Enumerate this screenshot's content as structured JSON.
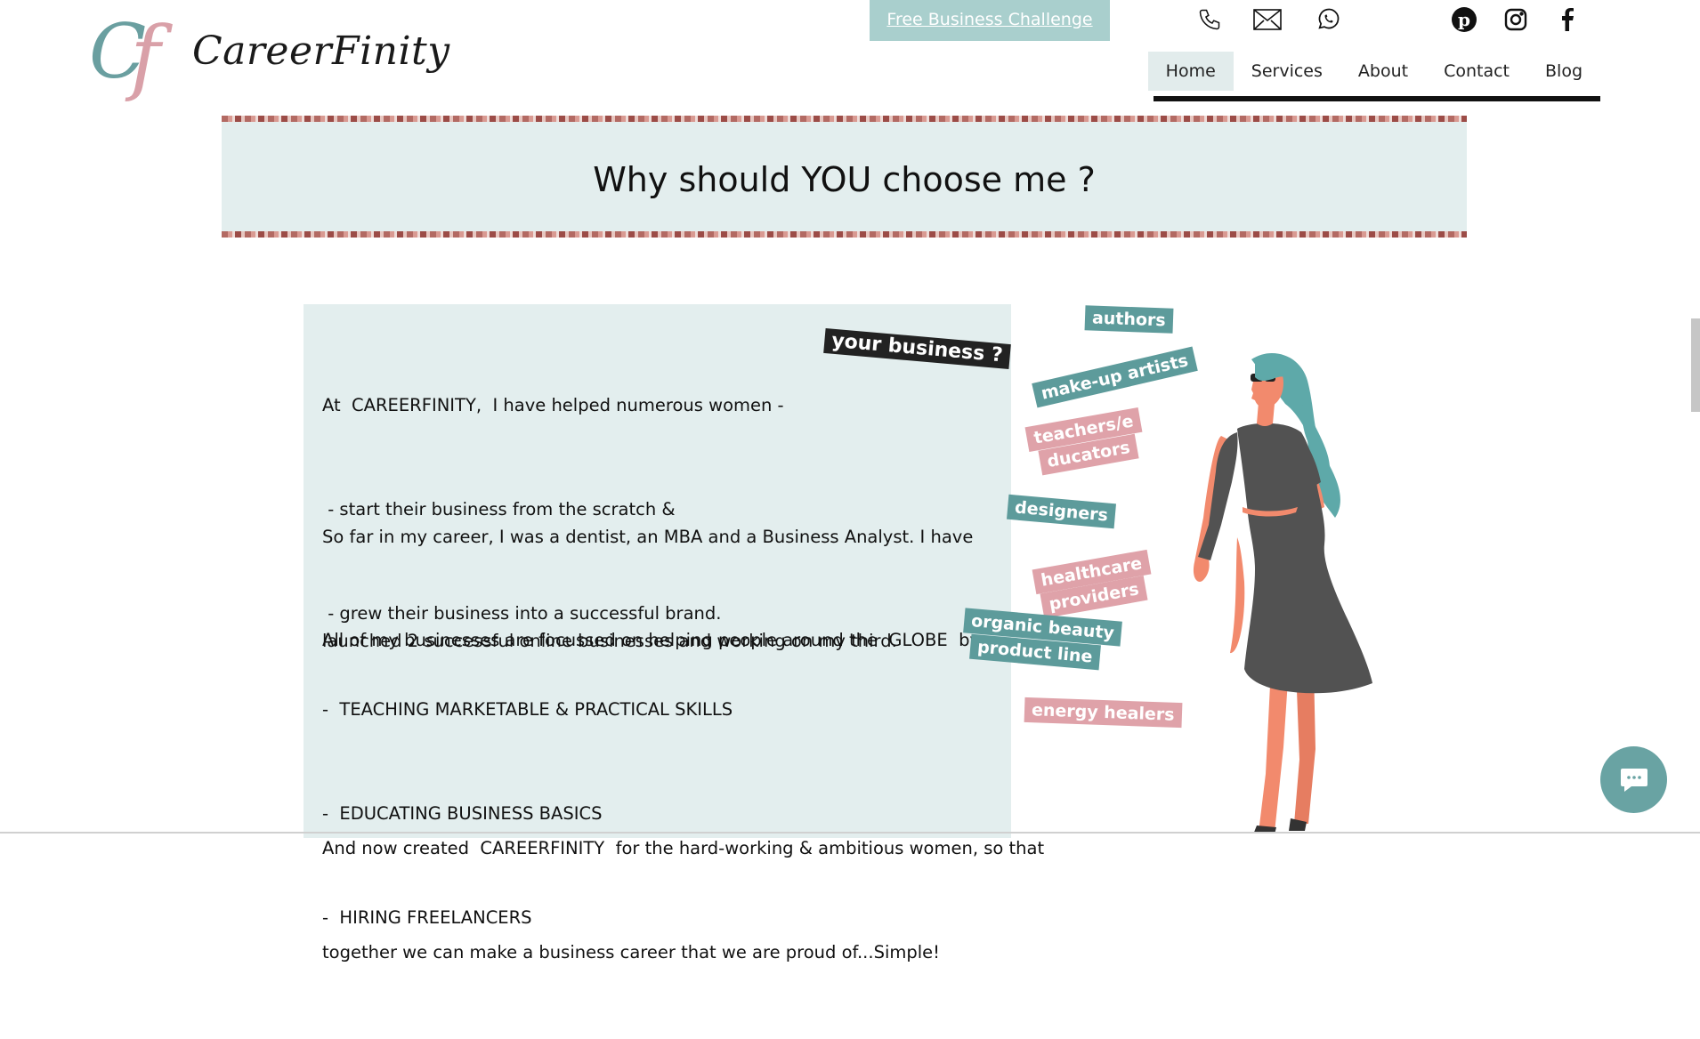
{
  "brand": {
    "logo_c": "C",
    "logo_f": "f",
    "name": "CareerFinity"
  },
  "header": {
    "cta_label": "Free Business Challenge",
    "contact_icons": [
      "phone-icon",
      "mail-icon",
      "whatsapp-icon"
    ],
    "social_icons": [
      "pinterest-icon",
      "instagram-icon",
      "facebook-icon"
    ]
  },
  "nav": {
    "items": [
      {
        "label": "Home",
        "active": true
      },
      {
        "label": "Services"
      },
      {
        "label": "About"
      },
      {
        "label": "Contact"
      },
      {
        "label": "Blog"
      }
    ]
  },
  "banner": {
    "title": "Why should YOU choose me ?"
  },
  "content": {
    "p1": [
      "At  CAREERFINITY,  I have helped numerous women -",
      " - start their business from the scratch &",
      " - grew their business into a successful brand."
    ],
    "p2": [
      "So far in my career, I was a dentist, an MBA and a Business Analyst. I have",
      "launched 2 successful online businesses and working on my third."
    ],
    "p3": [
      "All of my businesses are focussed on helping people around the  GLOBE  by --"
    ],
    "p4": [
      "-  TEACHING MARKETABLE & PRACTICAL SKILLS",
      "-  EDUCATING BUSINESS BASICS",
      "-  HIRING FREELANCERS"
    ],
    "p5": [
      "And now created  CAREERFINITY  for the hard-working & ambitious women, so that",
      "together we can make a business career that we are proud of...Simple!"
    ]
  },
  "illustration": {
    "headline": "your business ?",
    "tags": [
      "authors",
      "make-up artists",
      "teachers/e",
      "ducators",
      "designers",
      "healthcare",
      "providers",
      "organic beauty",
      "product line",
      "energy healers"
    ]
  },
  "colors": {
    "teal": "#5d9b9b",
    "pink": "#dfa2a9",
    "panel": "#e3eeee",
    "cta": "#a9cfcd"
  }
}
